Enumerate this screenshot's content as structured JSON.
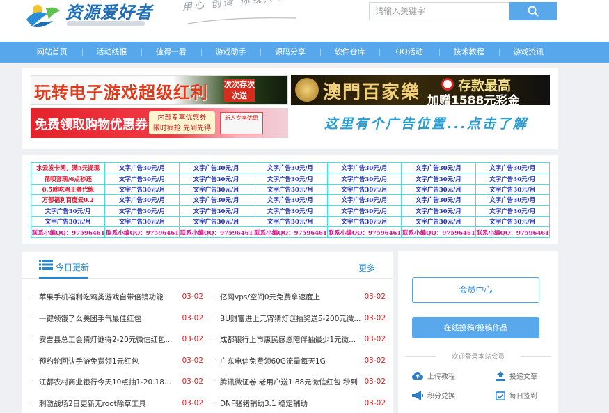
{
  "header": {
    "logo_text": "资源爱好者",
    "slogan": "用心 创造 你我共享",
    "search": {
      "placeholder": "请输入关键字"
    }
  },
  "nav": [
    "网站首页",
    "活动线报",
    "值得一看",
    "游戏助手",
    "源码分享",
    "软件仓库",
    "QQ活动",
    "技术教程",
    "游戏资讯"
  ],
  "banners": {
    "ad1": {
      "main": "玩转电子游戏超级红利",
      "side": "次次存次次送"
    },
    "ad2": {
      "main": "澳門百家樂",
      "top": "存款最高",
      "bottom": "加赠1588元彩金"
    },
    "ad3": {
      "main": "免费领取购物优惠券",
      "box1": "内部专享优惠券",
      "box2": "限时疯抢 先到先得",
      "gift": "新人专享优惠"
    },
    "ad4": {
      "main": "这里有个广告位置...点击了解"
    }
  },
  "text_ads": [
    [
      "水云发卡网，满5元提现",
      "文字广告30元/月",
      "文字广告30元/月",
      "文字广告30元/月",
      "文字广告30元/月",
      "文字广告30元/月",
      "文字广告30元/月"
    ],
    [
      "花呗套现/6点秒还",
      "文字广告30元/月",
      "文字广告30元/月",
      "文字广告30元/月",
      "文字广告30元/月",
      "文字广告30元/月",
      "文字广告30元/月"
    ],
    [
      "0.5就吃鸡王者代练",
      "文字广告30元/月",
      "文字广告30元/月",
      "文字广告30元/月",
      "文字广告30元/月",
      "文字广告30元/月",
      "文字广告30元/月"
    ],
    [
      "万部福利百度云0.2",
      "文字广告30元/月",
      "文字广告30元/月",
      "文字广告30元/月",
      "文字广告30元/月",
      "文字广告30元/月",
      "文字广告30元/月"
    ],
    [
      "文字广告30元/月",
      "文字广告30元/月",
      "文字广告30元/月",
      "文字广告30元/月",
      "文字广告30元/月",
      "文字广告30元/月",
      "文字广告30元/月"
    ],
    [
      "文字广告30元/月",
      "文字广告30元/月",
      "文字广告30元/月",
      "文字广告30元/月",
      "文字广告30元/月",
      "文字广告30元/月",
      "文字广告30元/月"
    ],
    [
      "联系小编QQ：97596461",
      "联系小编QQ：97596461",
      "联系小编QQ：97596461",
      "联系小编QQ：97596461",
      "联系小编QQ：97596461",
      "联系小编QQ：97596461",
      "联系小编QQ：97596461"
    ]
  ],
  "updates": {
    "title": "今日更新",
    "more": "更多",
    "left": [
      {
        "title": "苹果手机福利吃鸡类游戏自带倍镜功能",
        "date": "03-02"
      },
      {
        "title": "一键领饿了么美团手气最佳红包",
        "date": "03-02"
      },
      {
        "title": "安吉县总工会猜灯谜得2-20元微信红包...",
        "date": "03-02"
      },
      {
        "title": "预约轮回诀手游免费领1元红包",
        "date": "03-02"
      },
      {
        "title": "江都农村商业银行今天10点抽1-20.18元...",
        "date": "03-02"
      },
      {
        "title": "刺激战场2日更新无root除草工具",
        "date": "03-02"
      }
    ],
    "right": [
      {
        "title": "亿网vps/空间0元免费拿速度上",
        "date": "03-02"
      },
      {
        "title": "BU财富进上元宵猜灯谜抽奖送5-200元微...",
        "date": "03-02"
      },
      {
        "title": "成都银行上市惠民感恩陪伴抽最少1元微...",
        "date": "03-02"
      },
      {
        "title": "广东电信免费领60G流量每天1G",
        "date": "03-02"
      },
      {
        "title": "腾讯微证卷 老用户送1.88元微信红包 秒到",
        "date": "03-02"
      },
      {
        "title": "DNF骚猪辅助3.1 稳定辅助",
        "date": "03-02"
      }
    ]
  },
  "sidebar": {
    "member_center": "会员中心",
    "submit": "在线投稿/投稿作品",
    "welcome": "欢迎登录本站会员",
    "actions": [
      "上传教程",
      "投递文章",
      "积分兑换",
      "每日签到"
    ]
  },
  "colors": {
    "primary": "#56a7ec",
    "link": "#1e88d6",
    "date": "#e02020",
    "grid_border": "#35e6ea"
  }
}
